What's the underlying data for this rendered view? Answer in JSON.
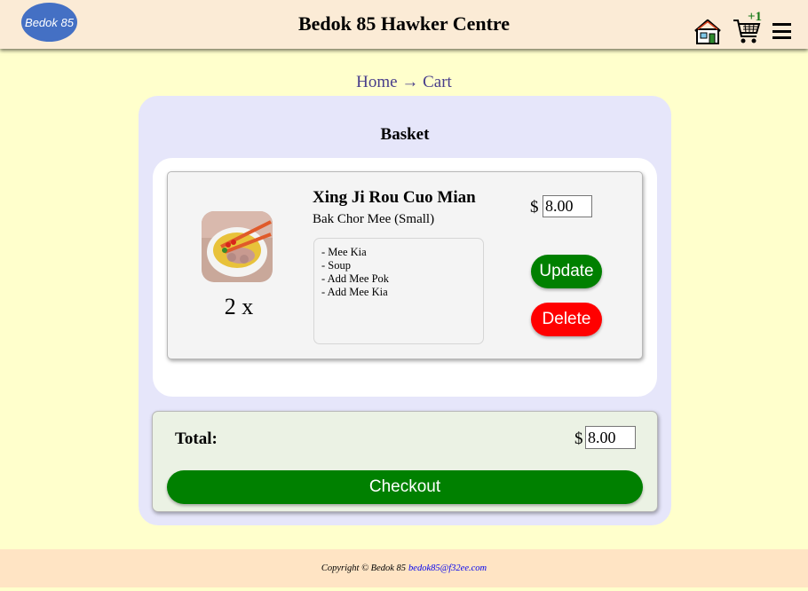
{
  "header": {
    "logo_text": "Bedok 85",
    "title": "Bedok 85 Hawker Centre",
    "cart_badge": "+1"
  },
  "breadcrumb": {
    "home": "Home",
    "separator": "→",
    "current": "Cart"
  },
  "basket": {
    "title": "Basket",
    "items": [
      {
        "quantity": "2 x",
        "stall": "Xing Ji Rou Cuo Mian",
        "dish": "Bak Chor Mee (Small)",
        "addons": [
          "- Mee Kia",
          "- Soup",
          "- Add Mee Pok",
          "- Add Mee Kia"
        ],
        "currency": "$",
        "price": "8.00",
        "update_label": "Update",
        "delete_label": "Delete"
      }
    ]
  },
  "total": {
    "label": "Total:",
    "currency": "$",
    "value": "8.00",
    "checkout_label": "Checkout"
  },
  "footer": {
    "copyright": "Copyright © Bedok 85",
    "email": "bedok85@f32ee.com"
  },
  "colors": {
    "page_bg": "#ffffcc",
    "header_bg": "#fbebd6",
    "card_bg": "#e6e6fa",
    "update": "#008000",
    "delete": "#ff0000",
    "checkout": "#008000",
    "logo": "#4470c4"
  },
  "icons": [
    "home-icon",
    "cart-icon",
    "menu-icon"
  ]
}
